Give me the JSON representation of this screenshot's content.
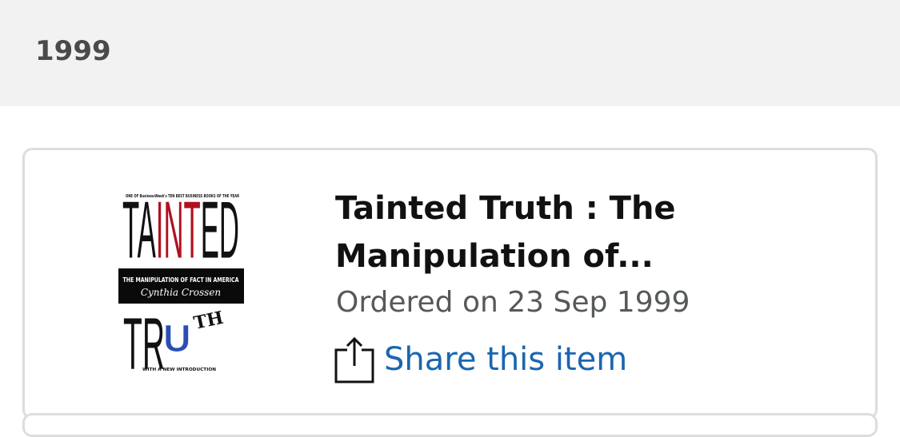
{
  "year_header": {
    "label": "1999"
  },
  "order": {
    "title": "Tainted Truth : The Manipulation of...",
    "date": "Ordered on 23 Sep 1999",
    "share_label": "Share this item",
    "cover": {
      "top_line": "ONE OF BusinessWeek's TEN BEST BUSINESS BOOKS OF THE YEAR",
      "word1_a": "TA",
      "word1_b": "INT",
      "word1_c": "ED",
      "band_line": "THE MANIPULATION OF FACT IN AMERICA",
      "author": "Cynthia Crossen",
      "word2_a": "TR",
      "word2_u": "U",
      "word2_b": "TH",
      "bottom_line": "WITH A NEW INTRODUCTION"
    }
  },
  "colors": {
    "link": "#1a66b0",
    "cover_red": "#b0111f",
    "cover_blue": "#2a4fb3"
  },
  "icons": {
    "share": "share-icon"
  }
}
